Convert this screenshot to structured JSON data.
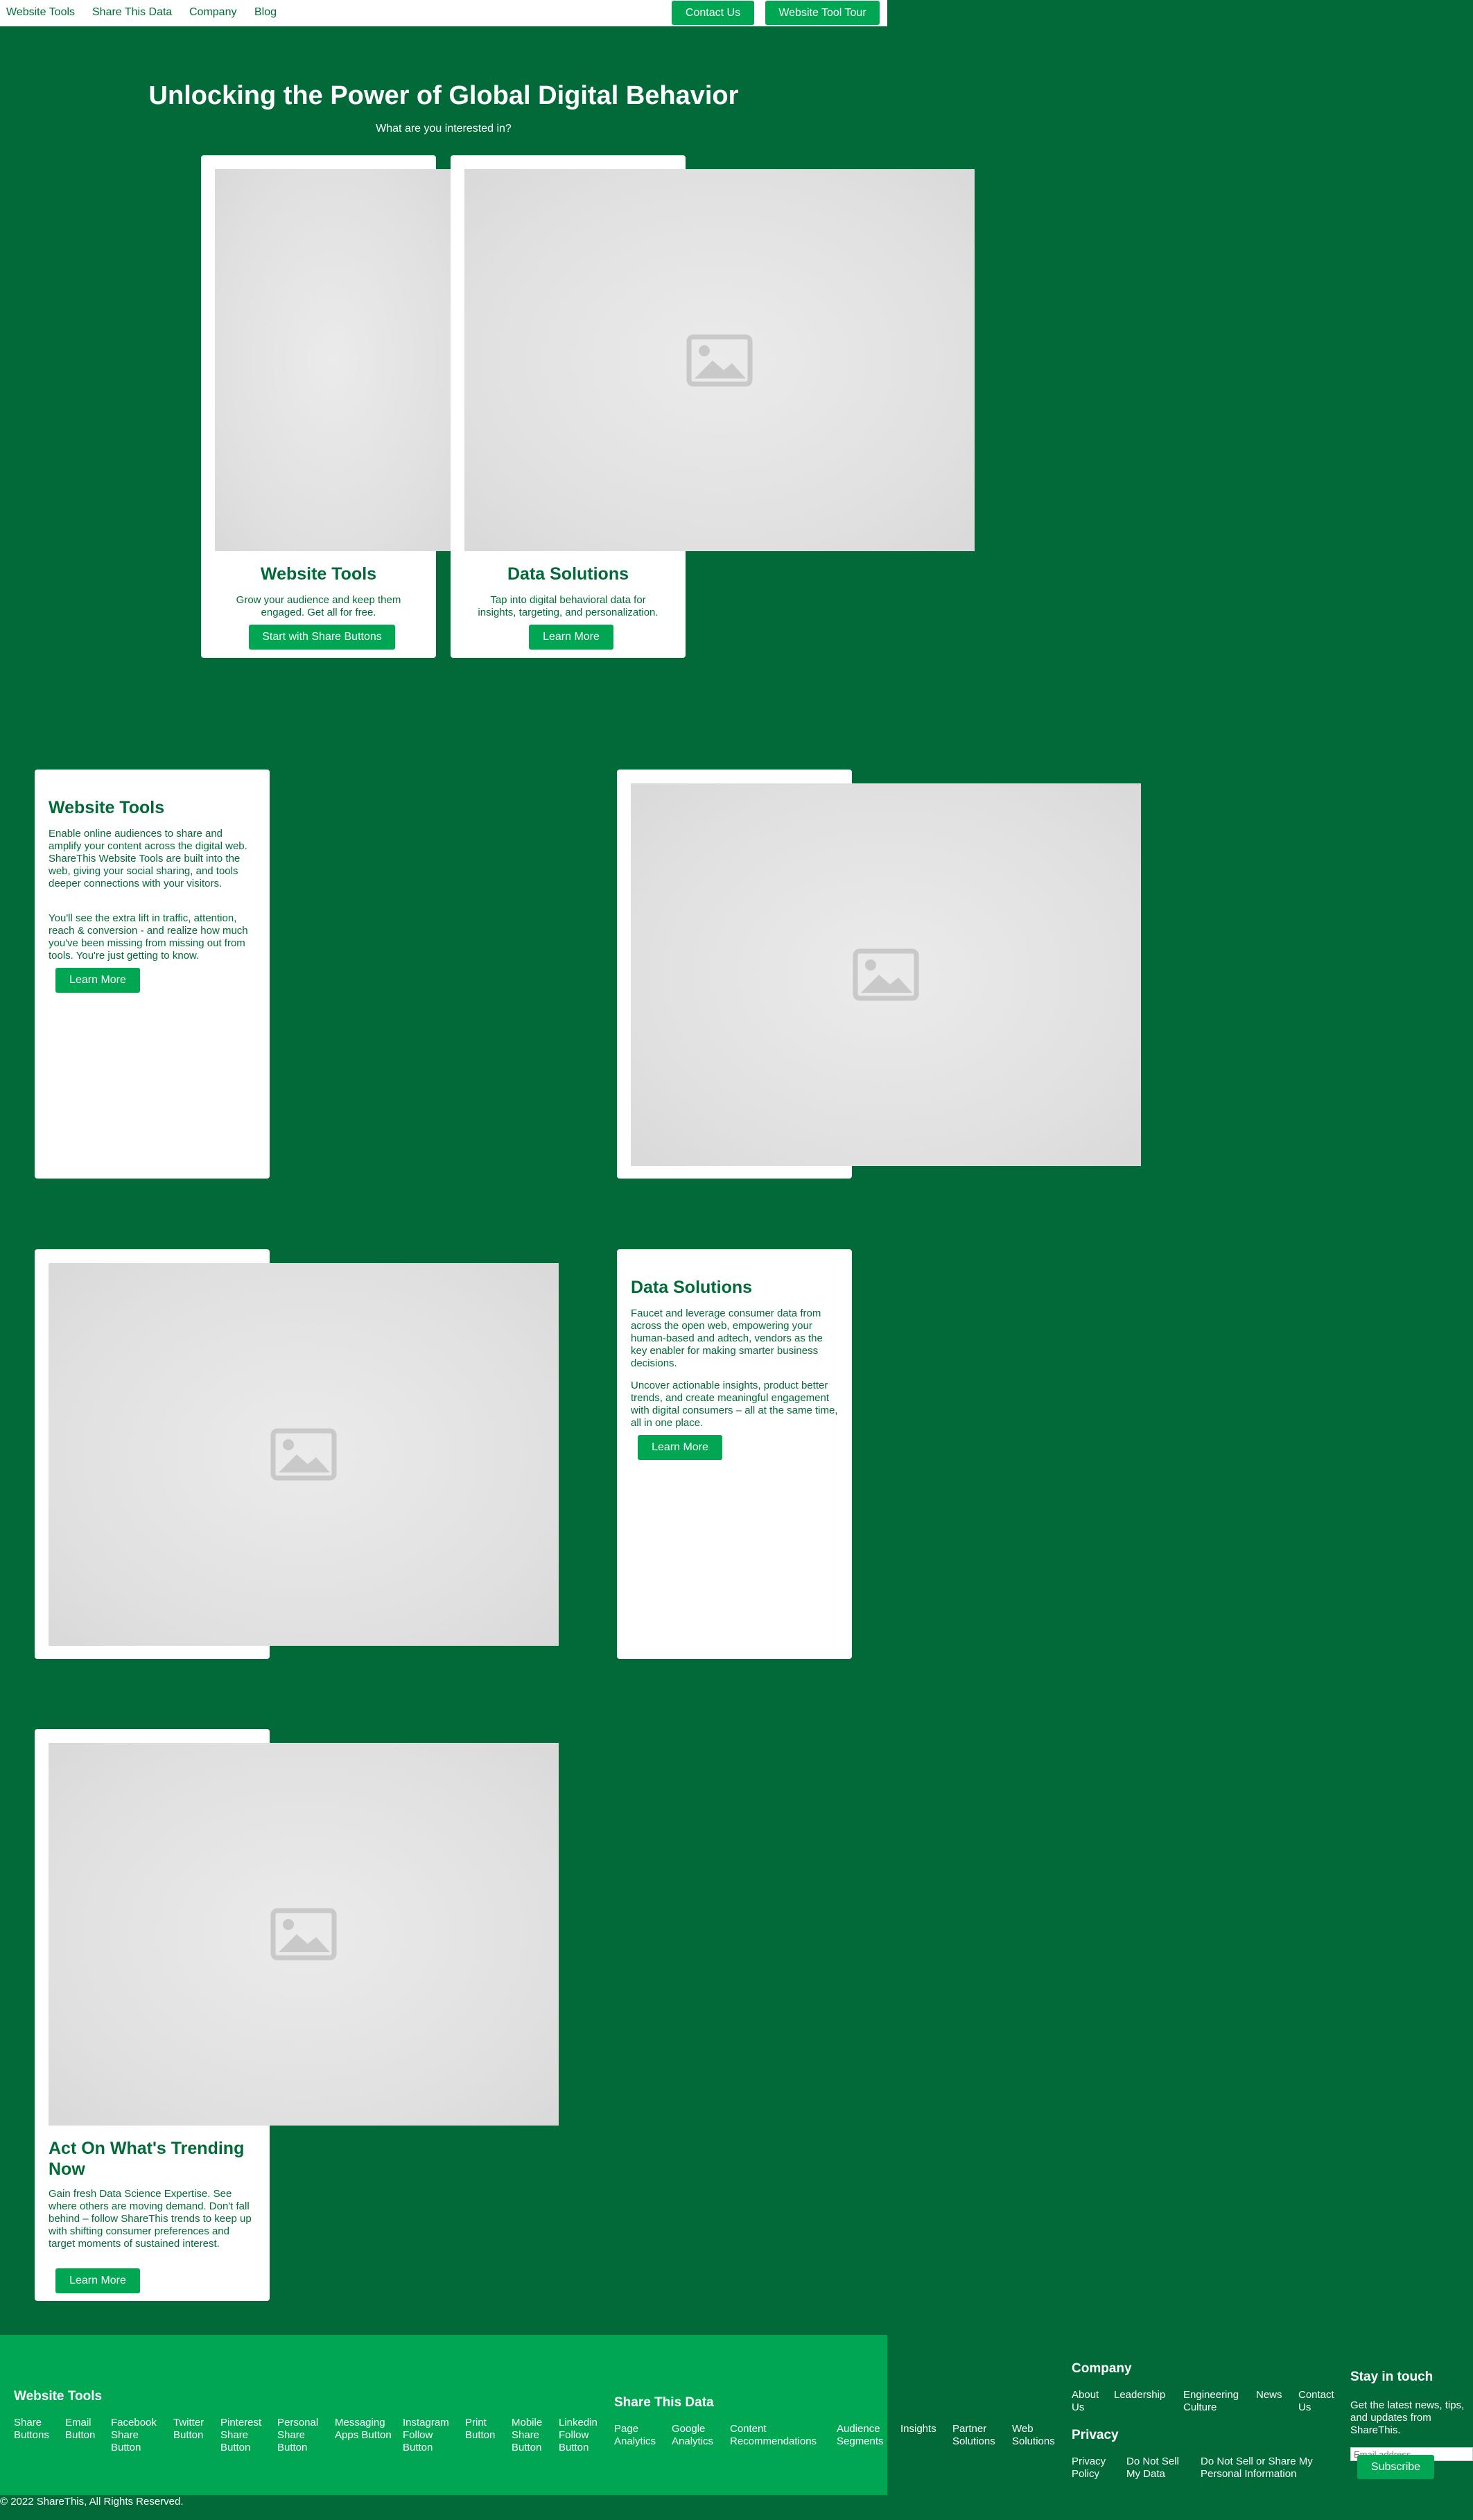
{
  "nav": {
    "links": [
      "Website Tools",
      "Share This Data",
      "Company",
      "Blog"
    ],
    "contact_label": "Contact Us",
    "tour_label": "Website Tool Tour"
  },
  "hero": {
    "title": "Unlocking the Power of Global Digital Behavior",
    "subtitle": "What are you interested in?",
    "cards": [
      {
        "title": "Website Tools",
        "desc": "Grow your audience and keep them engaged. Get all for free.",
        "button": "Start with Share Buttons",
        "image_icon": "image-placeholder-icon"
      },
      {
        "title": "Data Solutions",
        "desc": "Tap into digital behavioral data for insights, targeting, and personalization.",
        "button": "Learn More",
        "image_icon": "image-placeholder-icon"
      }
    ]
  },
  "sections": {
    "website_tools": {
      "title": "Website Tools",
      "p1": "Enable online audiences to share and amplify your content across the digital web. ShareThis Website Tools are built into the web, giving your social sharing, and tools deeper connections with your visitors.",
      "p2": "You'll see the extra lift in traffic, attention, reach & conversion - and realize how much you've been missing from missing out from tools. You're just getting to know.",
      "button": "Learn More"
    },
    "data_solutions": {
      "title": "Data Solutions",
      "p1": "Faucet and leverage consumer data from across the open web, empowering your human-based and adtech, vendors as the key enabler for making smarter business decisions.",
      "p2": "Uncover actionable insights, product better trends, and create meaningful engagement with digital consumers – all at the same time, all in one place.",
      "button": "Learn More"
    },
    "trending": {
      "title": "Act On What's Trending Now",
      "p1": "Gain fresh Data Science Expertise. See where others are moving demand. Don't fall behind – follow ShareThis trends to keep up with shifting consumer preferences and target moments of sustained interest.",
      "button": "Learn More"
    }
  },
  "footer": {
    "website_tools": {
      "heading": "Website Tools",
      "links": [
        "Share Buttons",
        "Email Button",
        "Facebook Share Button",
        "Twitter Button",
        "Pinterest Share Button",
        "Personal Share Button",
        "Messaging Apps Button",
        "Instagram Follow Button",
        "Print Button",
        "Mobile Share Button",
        "Linkedin Follow Button"
      ]
    },
    "share_this_data": {
      "heading": "Share This Data",
      "links": [
        "Page Analytics",
        "Google Analytics",
        "Content Recommendations",
        "Audience Segments",
        "Insights",
        "Partner Solutions",
        "Web Solutions"
      ]
    },
    "company": {
      "heading": "Company",
      "links": [
        "About Us",
        "Leadership",
        "Engineering Culture",
        "News",
        "Contact Us"
      ]
    },
    "privacy": {
      "heading": "Privacy",
      "links": [
        "Privacy Policy",
        "Do Not Sell My Data",
        "Do Not Sell or Share My Personal Information"
      ]
    },
    "stay": {
      "heading": "Stay in touch",
      "text": "Get the latest news, tips, and updates from ShareThis.",
      "email_placeholder": "Email address",
      "subscribe": "Subscribe"
    },
    "copyright": "© 2022 ShareThis, All Rights Reserved."
  },
  "colors": {
    "background": "#026a39",
    "accent": "#00a651",
    "text_dark": "#026a39",
    "card": "#ffffff"
  }
}
